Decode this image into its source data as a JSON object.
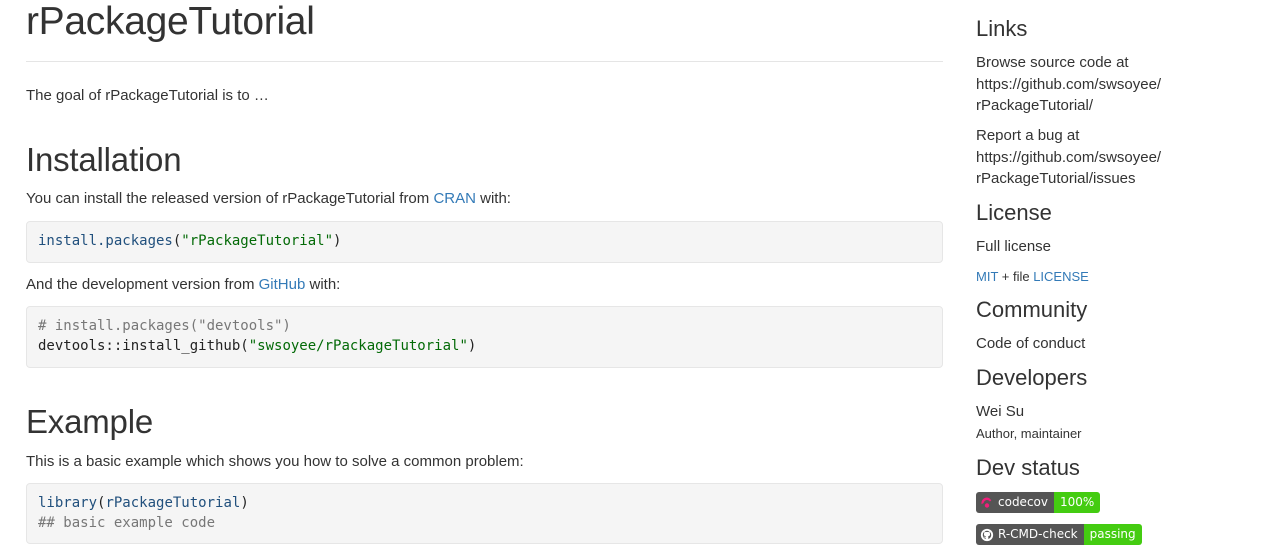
{
  "main": {
    "title": "rPackageTutorial",
    "intro": "The goal of rPackageTutorial is to …",
    "installation": {
      "heading": "Installation",
      "released_text_before": "You can install the released version of rPackageTutorial from ",
      "released_link": "CRAN",
      "released_text_after": " with:",
      "code1": {
        "fn": "install.packages",
        "open": "(",
        "arg": "\"rPackageTutorial\"",
        "close": ")"
      },
      "dev_text_before": "And the development version from ",
      "dev_link": "GitHub",
      "dev_text_after": " with:",
      "code2": {
        "comment": "# install.packages(\"devtools\")",
        "fn": "devtools::install_github",
        "open": "(",
        "arg": "\"swsoyee/rPackageTutorial\"",
        "close": ")"
      }
    },
    "example": {
      "heading": "Example",
      "text": "This is a basic example which shows you how to solve a common problem:",
      "code": {
        "fn": "library",
        "open": "(",
        "arg": "rPackageTutorial",
        "close": ")",
        "comment": "## basic example code"
      }
    }
  },
  "sidebar": {
    "links": {
      "heading": "Links",
      "browse_label": "Browse source code at",
      "browse_url_line1": "https://github.com/swsoyee/",
      "browse_url_line2": "rPackageTutorial/",
      "bug_label": "Report a bug at",
      "bug_url_line1": "https://github.com/swsoyee/",
      "bug_url_line2": "rPackageTutorial/issues"
    },
    "license": {
      "heading": "License",
      "full_link": "Full license",
      "mit": "MIT",
      "plus_file": " + file ",
      "license_file": "LICENSE"
    },
    "community": {
      "heading": "Community",
      "conduct_link": "Code of conduct"
    },
    "developers": {
      "heading": "Developers",
      "name": "Wei Su",
      "role": "Author, maintainer"
    },
    "dev_status": {
      "heading": "Dev status",
      "badges": [
        {
          "left": "codecov",
          "right": "100%",
          "icon": "codecov-icon",
          "right_color": "#4c1"
        },
        {
          "left": "R-CMD-check",
          "right": "passing",
          "icon": "github-icon",
          "right_color": "#4c1"
        }
      ]
    }
  }
}
